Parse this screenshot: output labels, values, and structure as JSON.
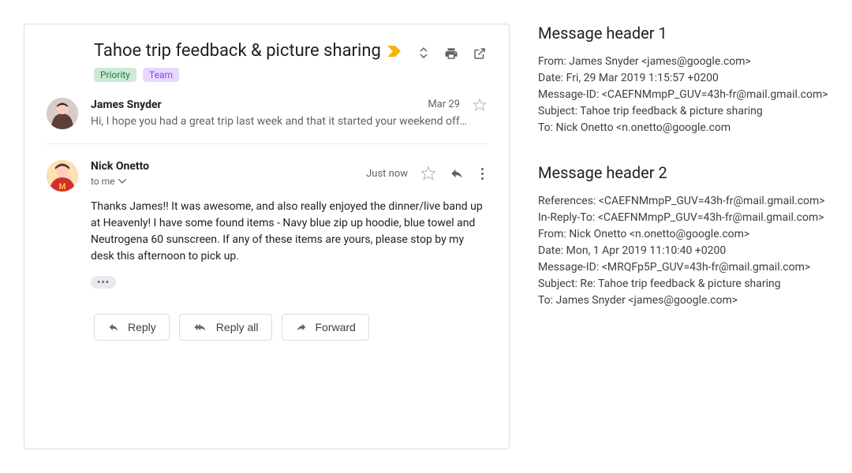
{
  "subject": "Tahoe trip feedback & picture sharing",
  "labels": {
    "priority": "Priority",
    "team": "Team"
  },
  "messages": {
    "m1": {
      "sender": "James Snyder",
      "date": "Mar 29",
      "snippet": "Hi, I hope you had a great trip last week and that it started your weekend off…"
    },
    "m2": {
      "sender": "Nick Onetto",
      "recipient": "to me",
      "date": "Just now",
      "body": "Thanks James!! It was awesome, and also really enjoyed the dinner/live band up at Heavenly! I have some found items - Navy blue zip up hoodie, blue towel and Neutrogena 60 sunscreen.  If any of these items are yours, please stop by my desk this afternoon to pick up."
    }
  },
  "actions": {
    "reply": "Reply",
    "reply_all": "Reply all",
    "forward": "Forward"
  },
  "side": {
    "h1": {
      "title": "Message header 1",
      "from": "From: James Snyder <james@google.com>",
      "date": "Date: Fri, 29 Mar 2019 1:15:57 +0200",
      "msgid": "Message-ID: <CAEFNMmpP_GUV=43h-fr@mail.gmail.com>",
      "subject": "Subject: Tahoe trip feedback & picture sharing",
      "to": "To:  Nick Onetto <n.onetto@google.com"
    },
    "h2": {
      "title": "Message header 2",
      "references": "References: <CAEFNMmpP_GUV=43h-fr@mail.gmail.com>",
      "inreplyto": "In-Reply-To: <CAEFNMmpP_GUV=43h-fr@mail.gmail.com>",
      "from": "From: Nick Onetto <n.onetto@google.com>",
      "date": "Date: Mon, 1 Apr 2019 11:10:40 +0200",
      "msgid": "Message-ID: <MRQFp5P_GUV=43h-fr@mail.gmail.com>",
      "subject": "Subject: Re: Tahoe trip feedback & picture sharing",
      "to": "To:  James Snyder <james@google.com>"
    }
  }
}
